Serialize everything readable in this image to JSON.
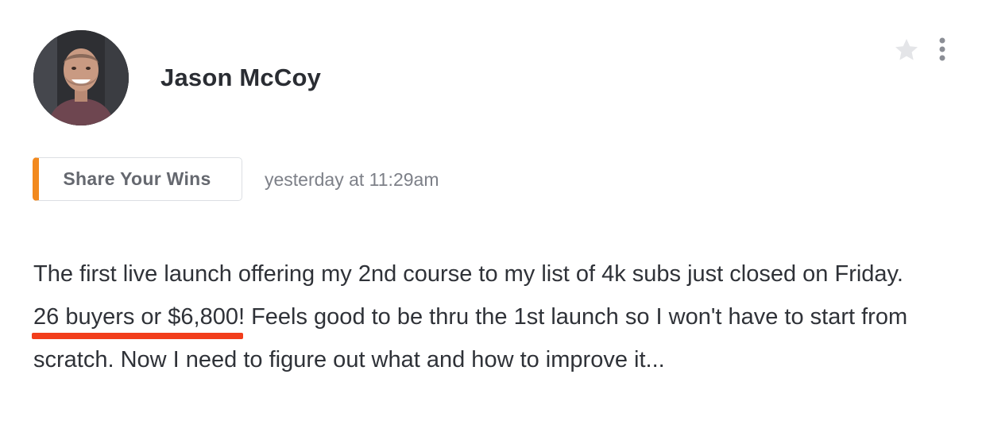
{
  "post": {
    "author": {
      "name": "Jason McCoy"
    },
    "actions": {
      "star_icon": "star-icon",
      "more_icon": "more-vertical-icon"
    },
    "category": {
      "label": "Share Your Wins",
      "accent_color": "#f2891e"
    },
    "timestamp": "yesterday at 11:29am",
    "body": {
      "text_before": "The first live launch offering my 2nd course to my list of 4k subs just closed on Friday. ",
      "highlight": "26 buyers or $6,800",
      "highlight_color": "#f23d1b",
      "text_after": "! Feels good to be thru the 1st launch so I won't have to start from scratch. Now I need to figure out what and how to improve it..."
    }
  }
}
